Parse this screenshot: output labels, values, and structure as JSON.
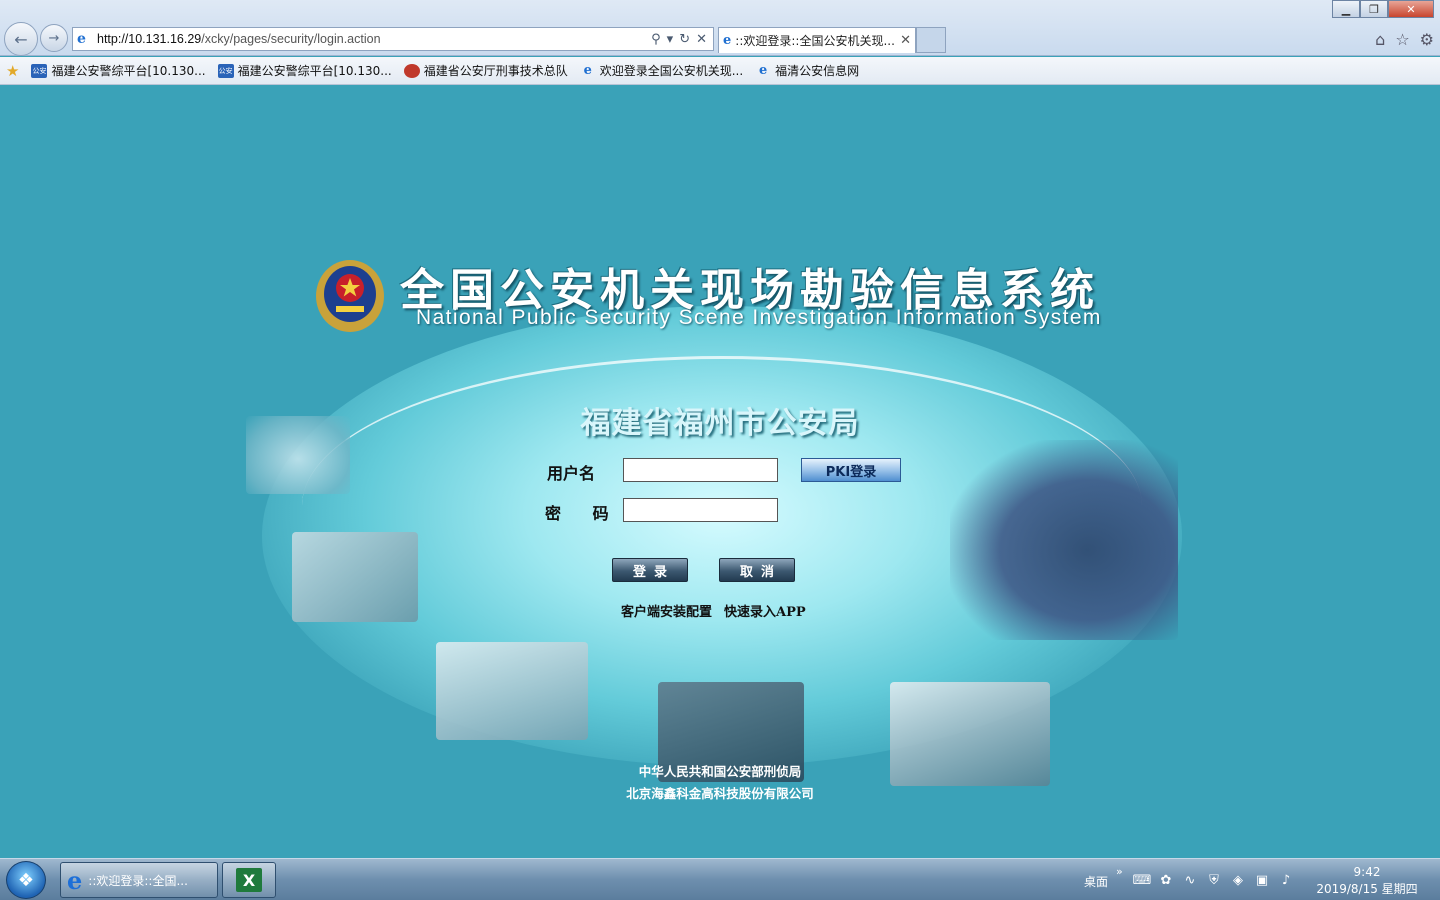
{
  "browser": {
    "address": "http://10.131.16.29/xcky/pages/security/login.action",
    "address_host": "http://10.131.16.29",
    "address_path": "/xcky/pages/security/login.action",
    "tab_title": "::欢迎登录::全国公安机关现...",
    "tab_close": "✕"
  },
  "favorites": [
    {
      "label": "福建公安警综平台[10.130...",
      "icon": "police-platform-icon"
    },
    {
      "label": "福建公安警综平台[10.130...",
      "icon": "police-platform-icon"
    },
    {
      "label": "福建省公安厅刑事技术总队",
      "icon": "badge-icon"
    },
    {
      "label": "欢迎登录全国公安机关现...",
      "icon": "ie-icon"
    },
    {
      "label": "福清公安信息网",
      "icon": "ie-icon"
    }
  ],
  "page": {
    "title_cn": "全国公安机关现场勘验信息系统",
    "title_en": "National Public Security Scene Investigation Information System",
    "org": "福建省福州市公安局",
    "username_label": "用户名",
    "password_label": "密 码",
    "pki_button": "PKI登录",
    "login_button": "登录",
    "cancel_button": "取消",
    "link_client": "客户端安装配置",
    "link_app": "快速录入APP",
    "footer_line1": "中华人民共和国公安部刑侦局",
    "footer_line2": "北京海鑫科金高科技股份有限公司"
  },
  "taskbar": {
    "ie_task": "::欢迎登录::全国...",
    "desktop_label": "桌面",
    "time": "9:42",
    "date": "2019/8/15 星期四"
  },
  "colors": {
    "page_bg": "#3aa2b8",
    "glow": "#d6fbff"
  }
}
